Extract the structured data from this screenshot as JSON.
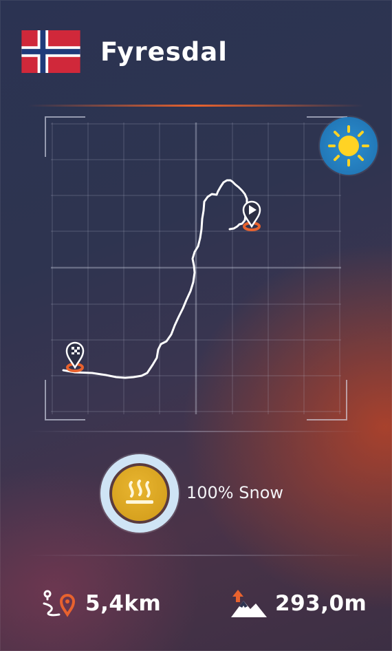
{
  "header": {
    "country_flag": "norway-flag",
    "title": "Fyresdal"
  },
  "map": {
    "start_marker": "finish-flag-marker-icon",
    "end_marker": "play-marker-icon",
    "route_color": "#ffffff",
    "marker_color": "#e8622e"
  },
  "weather": {
    "icon": "sun-icon",
    "color": "#2c8fd0"
  },
  "surface": {
    "icon": "heat-waves-icon",
    "label": "100% Snow"
  },
  "stats": {
    "distance": "5,4km",
    "distance_icon": "route-distance-icon",
    "elevation": "293,0m",
    "elevation_icon": "elevation-gain-icon"
  },
  "colors": {
    "accent": "#e8622e",
    "badge_gold": "#e0a928",
    "weather_blue": "#2c8fd0"
  }
}
